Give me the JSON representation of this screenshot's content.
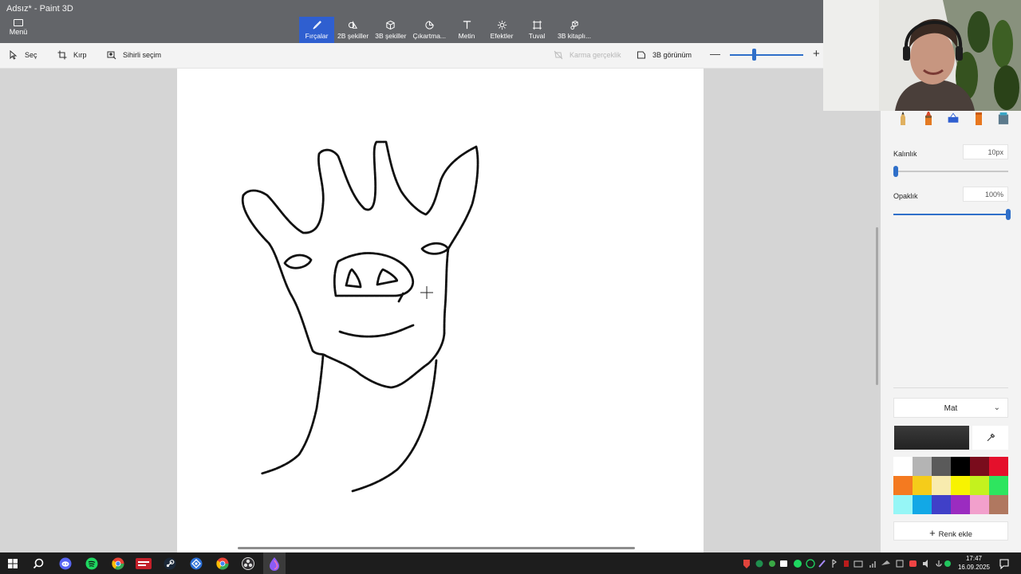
{
  "window": {
    "title": "Adsız* - Paint 3D"
  },
  "menu": {
    "label": "Menü",
    "icon": "folder-icon"
  },
  "ribbon": {
    "tabs": [
      {
        "label": "Fırçalar",
        "icon": "brush-icon",
        "active": true
      },
      {
        "label": "2B şekiller",
        "icon": "2d-shapes-icon"
      },
      {
        "label": "3B şekiller",
        "icon": "3d-shapes-icon"
      },
      {
        "label": "Çıkartma...",
        "icon": "sticker-icon"
      },
      {
        "label": "Metin",
        "icon": "text-icon"
      },
      {
        "label": "Efektler",
        "icon": "effects-icon"
      },
      {
        "label": "Tuval",
        "icon": "canvas-icon"
      },
      {
        "label": "3B kitaplı...",
        "icon": "3d-library-icon"
      }
    ]
  },
  "toolbar": {
    "select_label": "Seç",
    "crop_label": "Kırp",
    "magic_select_label": "Sihirli seçim",
    "mixed_reality_label": "Karma gerçeklik",
    "view_3d_label": "3B görünüm",
    "zoom_minus": "—",
    "zoom_plus": "+",
    "zoom_level": 0.33
  },
  "brush_panel": {
    "brushes": [
      "pencil-icon",
      "marker-icon",
      "calligraphy-pen-icon",
      "oil-brush-icon",
      "watercolor-icon"
    ],
    "thickness_label": "Kalınlık",
    "thickness_value": "10px",
    "thickness_level": 0.02,
    "opacity_label": "Opaklık",
    "opacity_value": "100%",
    "opacity_level": 1.0,
    "finish_label": "Mat",
    "current_color": "#222222",
    "palette": [
      "#ffffff",
      "#b4b4b4",
      "#5a5a5a",
      "#000000",
      "#7a0c1c",
      "#e5102c",
      "#f47a20",
      "#f5cc1a",
      "#f8ebae",
      "#f8f300",
      "#c4f21e",
      "#2ee55f",
      "#96f6f6",
      "#12a8e6",
      "#4040c8",
      "#9b2cc0",
      "#f2a0cc",
      "#b07860"
    ],
    "add_color_label": "Renk ekle"
  },
  "taskbar": {
    "apps": [
      "windows-start-icon",
      "search-icon",
      "discord-icon",
      "spotify-icon",
      "chrome-icon",
      "video-editor-icon",
      "steam-icon",
      "vpn-app-icon",
      "chrome-icon",
      "obs-icon",
      "paint-3d-icon"
    ],
    "clock_time": "17:47",
    "clock_date": "16.09.2025"
  }
}
